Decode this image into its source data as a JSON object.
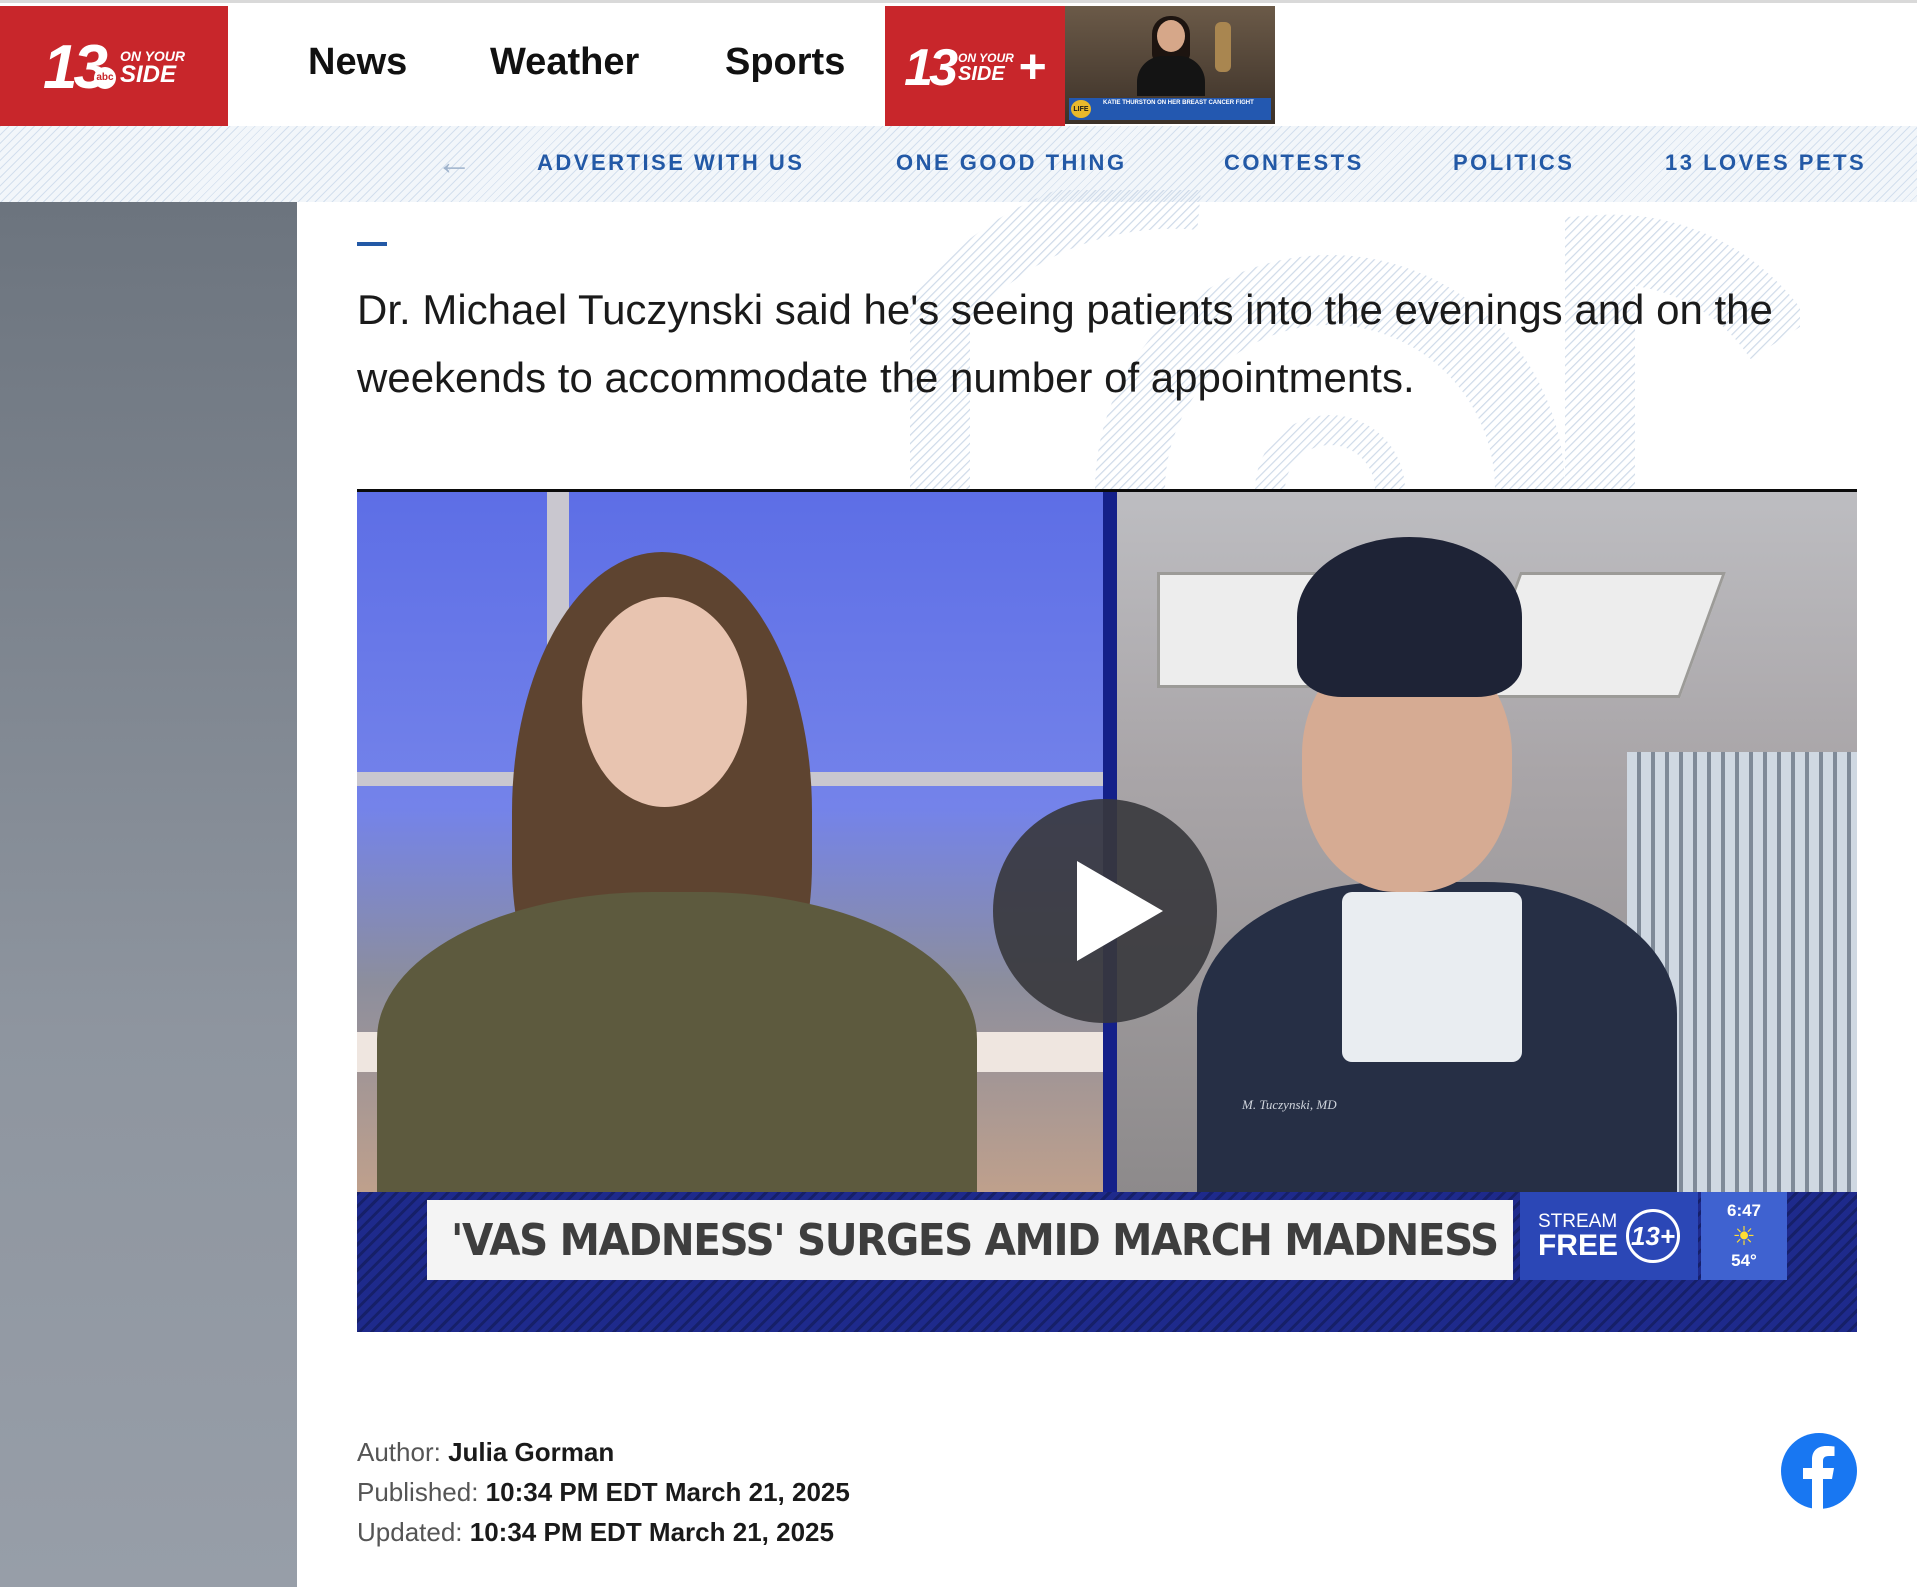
{
  "header": {
    "logo": {
      "number": "13",
      "line1": "ON YOUR",
      "line2": "SIDE",
      "abc": "abc"
    },
    "nav": [
      "News",
      "Weather",
      "Sports"
    ],
    "plus_logo": {
      "number": "13",
      "line1": "ON YOUR",
      "line2": "SIDE",
      "plus": "+"
    },
    "promo": {
      "badge": "LIFE",
      "caption": "KATIE THURSTON ON HER BREAST CANCER FIGHT"
    }
  },
  "subnav": {
    "back_icon": "arrow-left-icon",
    "items": [
      "ADVERTISE WITH US",
      "ONE GOOD THING",
      "CONTESTS",
      "POLITICS",
      "13 LOVES PETS"
    ]
  },
  "article": {
    "paragraph": "Dr. Michael Tuczynski said he's seeing patients into the evenings and on the weekends to accommodate the number of appointments."
  },
  "video": {
    "headline": "'VAS MADNESS' SURGES AMID MARCH MADNESS",
    "stream_line1": "STREAM",
    "stream_line2": "FREE",
    "stream_logo": "13+",
    "time": "6:47",
    "temperature": "54°",
    "scrub_name": "M. Tuczynski, MD",
    "play_icon": "play-icon"
  },
  "byline": {
    "author_label": "Author:",
    "author": "Julia Gorman",
    "published_label": "Published:",
    "published": "10:34 PM EDT March 21, 2025",
    "updated_label": "Updated:",
    "updated": "10:34 PM EDT March 21, 2025"
  },
  "share": {
    "facebook_icon": "facebook-icon"
  },
  "colors": {
    "brand_red": "#c8262b",
    "nav_blue": "#2359a6",
    "lower_third": "#1e2a8c",
    "facebook": "#1877f2"
  }
}
